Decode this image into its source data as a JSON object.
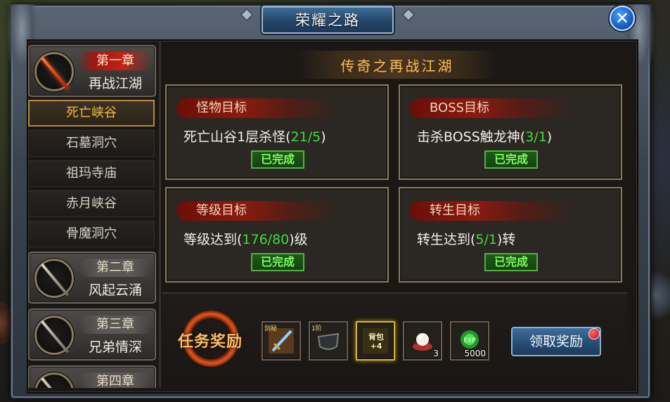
{
  "window": {
    "title": "荣耀之路",
    "close_label": "✕"
  },
  "sidebar": {
    "chapters": [
      {
        "num": "第一章",
        "name": "再战江湖",
        "active": true
      },
      {
        "num": "第二章",
        "name": "风起云涌",
        "active": false
      },
      {
        "num": "第三章",
        "name": "兄弟情深",
        "active": false
      },
      {
        "num": "第四章",
        "name": "",
        "active": false
      }
    ],
    "sub_items": [
      {
        "label": "死亡峡谷",
        "active": true
      },
      {
        "label": "石墓洞穴",
        "active": false
      },
      {
        "label": "祖玛寺庙",
        "active": false
      },
      {
        "label": "赤月峡谷",
        "active": false
      },
      {
        "label": "骨魔洞穴",
        "active": false
      }
    ]
  },
  "main": {
    "banner": "传奇之再战江湖",
    "objectives": [
      {
        "title": "怪物目标",
        "text_pre": "死亡山谷1层杀怪(",
        "progress": "21/5",
        "text_post": ")",
        "status": "已完成"
      },
      {
        "title": "BOSS目标",
        "text_pre": "击杀BOSS触龙神(",
        "progress": "3/1",
        "text_post": ")",
        "status": "已完成"
      },
      {
        "title": "等级目标",
        "text_pre": "等级达到(",
        "progress": "176/80",
        "text_post": ")级",
        "status": "已完成"
      },
      {
        "title": "转生目标",
        "text_pre": "转生达到(",
        "progress": "5/1",
        "text_post": ")转",
        "status": "已完成"
      }
    ]
  },
  "rewards": {
    "heading": "任务奖励",
    "items": [
      {
        "icon": "sword-book-icon",
        "tag": "剑秘",
        "qty": ""
      },
      {
        "icon": "armor-piece-icon",
        "tag": "1阶",
        "qty": ""
      },
      {
        "icon": "backpack-upgrade-icon",
        "tag": "背包+4",
        "qty": ""
      },
      {
        "icon": "crystal-orb-icon",
        "tag": "",
        "qty": "3"
      },
      {
        "icon": "exp-orb-icon",
        "tag": "EXP",
        "qty": "5000"
      }
    ],
    "claim_label": "领取奖励"
  },
  "colors": {
    "progress_green": "#3dde3d",
    "banner_gold": "#f4c263",
    "active_tab": "#f3bb43",
    "notify_red": "#d40000"
  }
}
